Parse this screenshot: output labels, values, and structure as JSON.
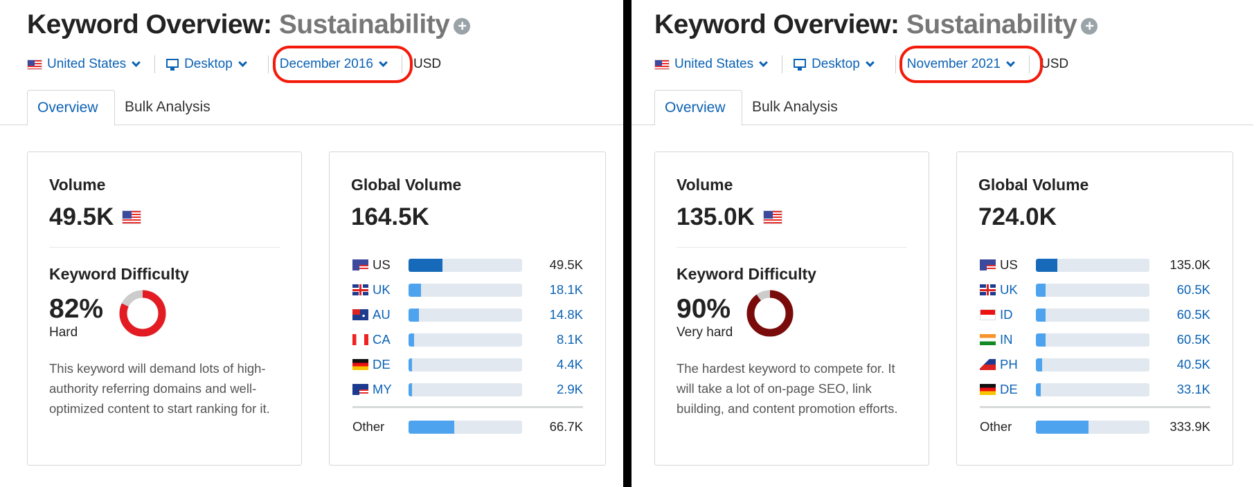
{
  "colors": {
    "accent": "#0b62b4",
    "highlight": "#f41a0a",
    "bar_primary": "#1769b9",
    "bar_secondary": "#4da3ee",
    "bar_track": "#e1e8ef",
    "donut_remainder": "#cccccc"
  },
  "panels": [
    {
      "title_prefix": "Keyword Overview:",
      "keyword": "Sustainability",
      "add_icon": "plus-circle-icon",
      "country": "United States",
      "device": "Desktop",
      "date": "December 2016",
      "currency": "USD",
      "tabs": [
        "Overview",
        "Bulk Analysis"
      ],
      "volume": {
        "label": "Volume",
        "value": "49.5K"
      },
      "kd": {
        "label": "Keyword Difficulty",
        "percent": 82,
        "percent_text": "82%",
        "level": "Hard",
        "color": "#e31b23",
        "description": "This keyword will demand lots of high-authority referring domains and well-optimized content to start ranking for it."
      },
      "global": {
        "label": "Global Volume",
        "value": "164.5K",
        "total": 164.5,
        "rows": [
          {
            "code": "US",
            "flag": "us",
            "value": "49.5K",
            "num": 49.5
          },
          {
            "code": "UK",
            "flag": "uk",
            "value": "18.1K",
            "num": 18.1
          },
          {
            "code": "AU",
            "flag": "au",
            "value": "14.8K",
            "num": 14.8
          },
          {
            "code": "CA",
            "flag": "ca",
            "value": "8.1K",
            "num": 8.1
          },
          {
            "code": "DE",
            "flag": "de",
            "value": "4.4K",
            "num": 4.4
          },
          {
            "code": "MY",
            "flag": "my",
            "value": "2.9K",
            "num": 2.9
          }
        ],
        "other": {
          "label": "Other",
          "value": "66.7K",
          "num": 66.7
        }
      }
    },
    {
      "title_prefix": "Keyword Overview:",
      "keyword": "Sustainability",
      "add_icon": "plus-circle-icon",
      "country": "United States",
      "device": "Desktop",
      "date": "November 2021",
      "currency": "USD",
      "tabs": [
        "Overview",
        "Bulk Analysis"
      ],
      "volume": {
        "label": "Volume",
        "value": "135.0K"
      },
      "kd": {
        "label": "Keyword Difficulty",
        "percent": 90,
        "percent_text": "90%",
        "level": "Very hard",
        "color": "#7a0b0b",
        "description": "The hardest keyword to compete for. It will take a lot of on-page SEO, link building, and content promotion efforts."
      },
      "global": {
        "label": "Global Volume",
        "value": "724.0K",
        "total": 724.0,
        "rows": [
          {
            "code": "US",
            "flag": "us",
            "value": "135.0K",
            "num": 135.0
          },
          {
            "code": "UK",
            "flag": "uk",
            "value": "60.5K",
            "num": 60.5
          },
          {
            "code": "ID",
            "flag": "id",
            "value": "60.5K",
            "num": 60.5
          },
          {
            "code": "IN",
            "flag": "in",
            "value": "60.5K",
            "num": 60.5
          },
          {
            "code": "PH",
            "flag": "ph",
            "value": "40.5K",
            "num": 40.5
          },
          {
            "code": "DE",
            "flag": "de",
            "value": "33.1K",
            "num": 33.1
          }
        ],
        "other": {
          "label": "Other",
          "value": "333.9K",
          "num": 333.9
        }
      }
    }
  ]
}
